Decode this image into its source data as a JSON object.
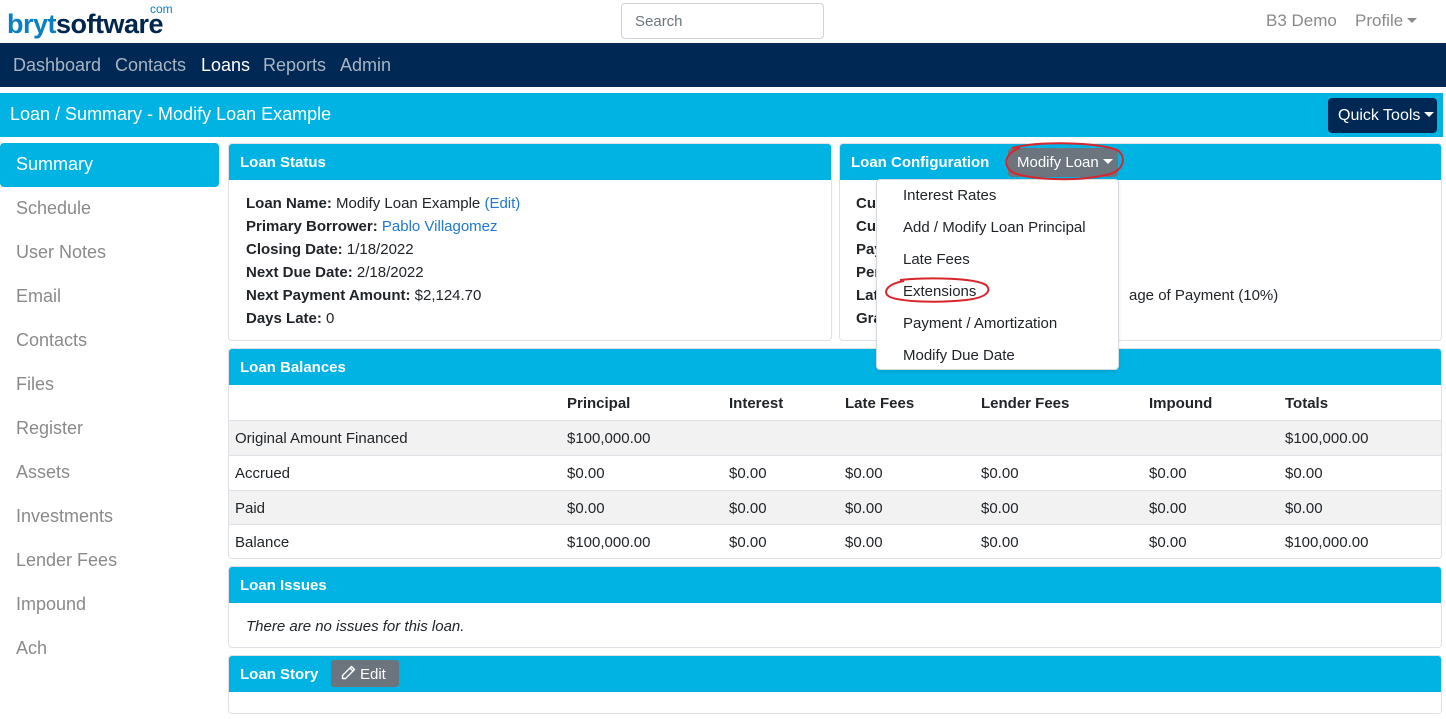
{
  "brand": {
    "name_part1": "bryt",
    "name_part2": "software",
    "suffix": "com"
  },
  "search": {
    "placeholder": "Search"
  },
  "user": {
    "account": "B3 Demo",
    "profile_label": "Profile"
  },
  "nav": {
    "items": [
      "Dashboard",
      "Contacts",
      "Loans",
      "Reports",
      "Admin"
    ],
    "active": "Loans"
  },
  "page": {
    "title": "Loan / Summary - Modify Loan Example",
    "quick_tools_label": "Quick Tools"
  },
  "sidebar": {
    "items": [
      "Summary",
      "Schedule",
      "User Notes",
      "Email",
      "Contacts",
      "Files",
      "Register",
      "Assets",
      "Investments",
      "Lender Fees",
      "Impound",
      "Ach"
    ],
    "active": "Summary"
  },
  "loan_status": {
    "header": "Loan Status",
    "loan_name_label": "Loan Name:",
    "loan_name": "Modify Loan Example",
    "edit_link": "(Edit)",
    "borrower_label": "Primary Borrower:",
    "borrower": "Pablo Villagomez",
    "closing_label": "Closing Date:",
    "closing_date": "1/18/2022",
    "next_due_label": "Next Due Date:",
    "next_due_date": "2/18/2022",
    "next_payment_label": "Next Payment Amount:",
    "next_payment": "$2,124.70",
    "days_late_label": "Days Late:",
    "days_late": "0"
  },
  "loan_config": {
    "header": "Loan Configuration",
    "modify_button": "Modify Loan",
    "partial_labels": [
      "Cu",
      "Cu",
      "Pay",
      "Per",
      "Lat",
      "Gra"
    ],
    "late_fee_tail": "age of Payment (10%)"
  },
  "modify_menu": {
    "items": [
      "Interest Rates",
      "Add / Modify Loan Principal",
      "Late Fees",
      "Extensions",
      "Payment / Amortization",
      "Modify Due Date"
    ]
  },
  "loan_balances": {
    "header": "Loan Balances",
    "columns": [
      "",
      "Principal",
      "Interest",
      "Late Fees",
      "Lender Fees",
      "Impound",
      "Totals"
    ],
    "rows": [
      [
        "Original Amount Financed",
        "$100,000.00",
        "",
        "",
        "",
        "",
        "$100,000.00"
      ],
      [
        "Accrued",
        "$0.00",
        "$0.00",
        "$0.00",
        "$0.00",
        "$0.00",
        "$0.00"
      ],
      [
        "Paid",
        "$0.00",
        "$0.00",
        "$0.00",
        "$0.00",
        "$0.00",
        "$0.00"
      ],
      [
        "Balance",
        "$100,000.00",
        "$0.00",
        "$0.00",
        "$0.00",
        "$0.00",
        "$100,000.00"
      ]
    ]
  },
  "loan_issues": {
    "header": "Loan Issues",
    "message": "There are no issues for this loan."
  },
  "loan_story": {
    "header": "Loan Story",
    "edit_button": "Edit"
  },
  "colors": {
    "navy": "#002855",
    "cyan": "#00b3e3",
    "link": "#1f78d1",
    "annotation": "#d9262c"
  }
}
